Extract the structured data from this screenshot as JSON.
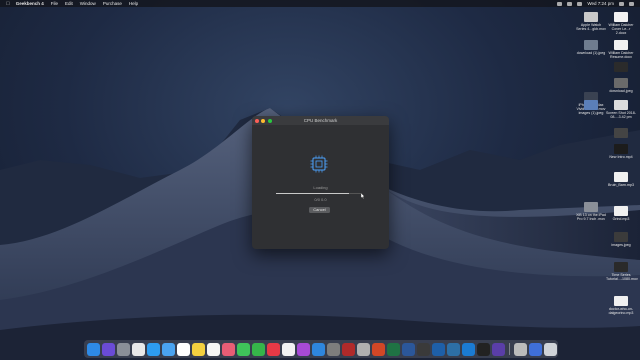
{
  "menubar": {
    "app_name": "Geekbench 4",
    "items": [
      "File",
      "Edit",
      "Window",
      "Purchase",
      "Help"
    ],
    "clock": "Wed 7:24 pm"
  },
  "window": {
    "title": "CPU Benchmark",
    "status_label": "Loading",
    "progress": 0.85,
    "sub_label": "0/0 0.0",
    "cancel_label": "Cancel"
  },
  "desktop_icons": [
    {
      "label": "Apple Watch Series 4...gkb.mov",
      "color": "#c9c9c9"
    },
    {
      "label": "William Dalcher Cover Le...r 2.docx",
      "color": "#f2f2f2"
    },
    {
      "label": "download (1).jpeg",
      "color": "#6f7c8f"
    },
    {
      "label": "William Dalcher Resume.docx",
      "color": "#f2f2f2"
    },
    {
      "label": "",
      "color": "#2b2b2b"
    },
    {
      "label": "iPhone XS Max Vivid bl...ckm.mov",
      "color": "#3a4252"
    },
    {
      "label": "download.jpeg",
      "color": "#6a6a6a"
    },
    {
      "label": "images (1).jpeg",
      "color": "#5b7fb8"
    },
    {
      "label": "Screen Shot 2018-08-...3.42 pm",
      "color": "#dcdcdc"
    },
    {
      "label": "",
      "color": "#444"
    },
    {
      "label": "New Intro.mp4",
      "color": "#1c1c1c"
    },
    {
      "label": "Bruin_Barn.mp3",
      "color": "#f0f0f0"
    },
    {
      "label": "XiB 13 on the iPad Pro 9.7 Inch .mov",
      "color": "#8a8f98"
    },
    {
      "label": "Grind.mp3",
      "color": "#f0f0f0"
    },
    {
      "label": "images.jpeg",
      "color": "#3b3b3b"
    },
    {
      "label": "Time Series Tutorial...-1080.mov",
      "color": "#2a2a2a"
    },
    {
      "label": "doctor-who-on-dalgeorino.mp3",
      "color": "#f0f0f0"
    }
  ],
  "dock_apps": [
    {
      "name": "finder-icon",
      "color": "#2e8ae6"
    },
    {
      "name": "siri-icon",
      "color": "#6a4bd6"
    },
    {
      "name": "launchpad-icon",
      "color": "#8a8f98"
    },
    {
      "name": "chrome-icon",
      "color": "#e8e8e8"
    },
    {
      "name": "safari-icon",
      "color": "#2d9cf0"
    },
    {
      "name": "mail-icon",
      "color": "#4aa3f0"
    },
    {
      "name": "calendar-icon",
      "color": "#ffffff"
    },
    {
      "name": "notes-icon",
      "color": "#f4d03f"
    },
    {
      "name": "reminders-icon",
      "color": "#f5f5f5"
    },
    {
      "name": "photos-icon",
      "color": "#e85d75"
    },
    {
      "name": "messages-icon",
      "color": "#3fc35a"
    },
    {
      "name": "facetime-icon",
      "color": "#36b54a"
    },
    {
      "name": "news-icon",
      "color": "#e63946"
    },
    {
      "name": "music-icon",
      "color": "#f2f2f2"
    },
    {
      "name": "podcasts-icon",
      "color": "#a64ad6"
    },
    {
      "name": "app-store-icon",
      "color": "#2e86de"
    },
    {
      "name": "system-preferences-icon",
      "color": "#7d7d7d"
    },
    {
      "name": "photo-booth-icon",
      "color": "#b02a2a"
    },
    {
      "name": "preview-icon",
      "color": "#b0b0b0"
    },
    {
      "name": "powerpoint-icon",
      "color": "#d24726"
    },
    {
      "name": "excel-icon",
      "color": "#1f7244"
    },
    {
      "name": "word-icon",
      "color": "#2b579a"
    },
    {
      "name": "final-cut-icon",
      "color": "#3a3a3a"
    },
    {
      "name": "quicktime-icon",
      "color": "#1e5fa8"
    },
    {
      "name": "edge-icon",
      "color": "#2d6fa6"
    },
    {
      "name": "xcode-icon",
      "color": "#1b7bd3"
    },
    {
      "name": "terminal-icon",
      "color": "#222"
    },
    {
      "name": "geekbench-icon",
      "color": "#5a3ea8"
    }
  ],
  "dock_right": [
    {
      "name": "iphone-icon",
      "color": "#bbb"
    },
    {
      "name": "downloads-icon",
      "color": "#3f6fd8"
    },
    {
      "name": "trash-icon",
      "color": "#cfd3d8"
    }
  ]
}
